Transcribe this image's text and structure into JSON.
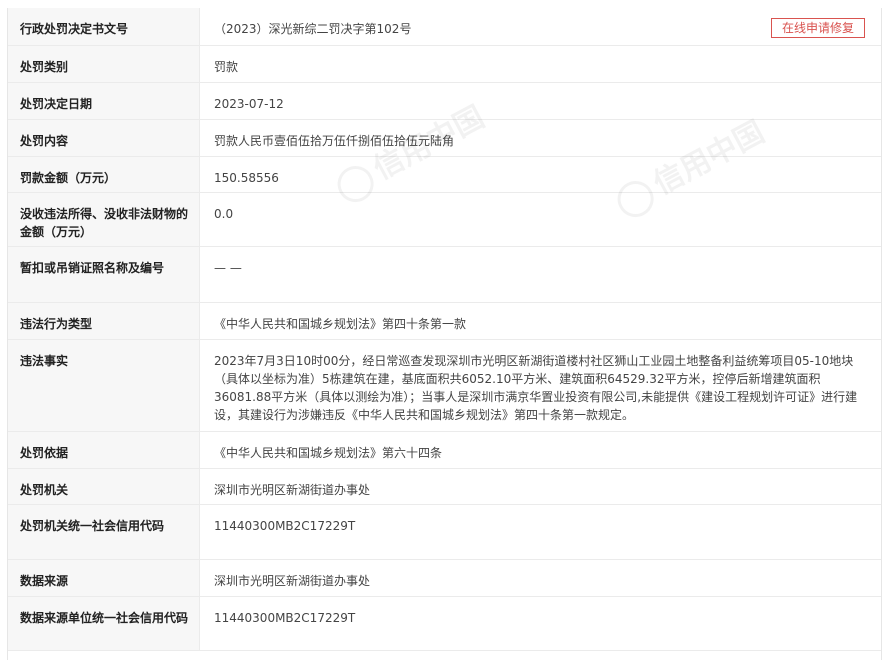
{
  "repair_button": "在线申请修复",
  "watermark": "信用中国",
  "rows": [
    {
      "label": "行政处罚决定书文号",
      "value": "（2023）深光新综二罚决字第102号"
    },
    {
      "label": "处罚类别",
      "value": "罚款"
    },
    {
      "label": "处罚决定日期",
      "value": "2023-07-12"
    },
    {
      "label": "处罚内容",
      "value": "罚款人民币壹佰伍拾万伍仟捌佰伍拾伍元陆角"
    },
    {
      "label": "罚款金额（万元）",
      "value": "150.58556"
    },
    {
      "label": "没收违法所得、没收非法财物的金额（万元）",
      "value": "0.0"
    },
    {
      "label": "暂扣或吊销证照名称及编号",
      "value": "— —"
    },
    {
      "label": "违法行为类型",
      "value": "《中华人民共和国城乡规划法》第四十条第一款"
    },
    {
      "label": "违法事实",
      "value": "2023年7月3日10时00分，经日常巡查发现深圳市光明区新湖街道楼村社区狮山工业园土地整备利益统筹项目05-10地块（具体以坐标为准）5栋建筑在建，基底面积共6052.10平方米、建筑面积64529.32平方米，控停后新增建筑面积36081.88平方米（具体以测绘为准）；当事人是深圳市满京华置业投资有限公司,未能提供《建设工程规划许可证》进行建设，其建设行为涉嫌违反《中华人民共和国城乡规划法》第四十条第一款规定。"
    },
    {
      "label": "处罚依据",
      "value": "《中华人民共和国城乡规划法》第六十四条"
    },
    {
      "label": "处罚机关",
      "value": "深圳市光明区新湖街道办事处"
    },
    {
      "label": "处罚机关统一社会信用代码",
      "value": "11440300MB2C17229T"
    },
    {
      "label": "数据来源",
      "value": "深圳市光明区新湖街道办事处"
    },
    {
      "label": "数据来源单位统一社会信用代码",
      "value": "11440300MB2C17229T"
    }
  ]
}
